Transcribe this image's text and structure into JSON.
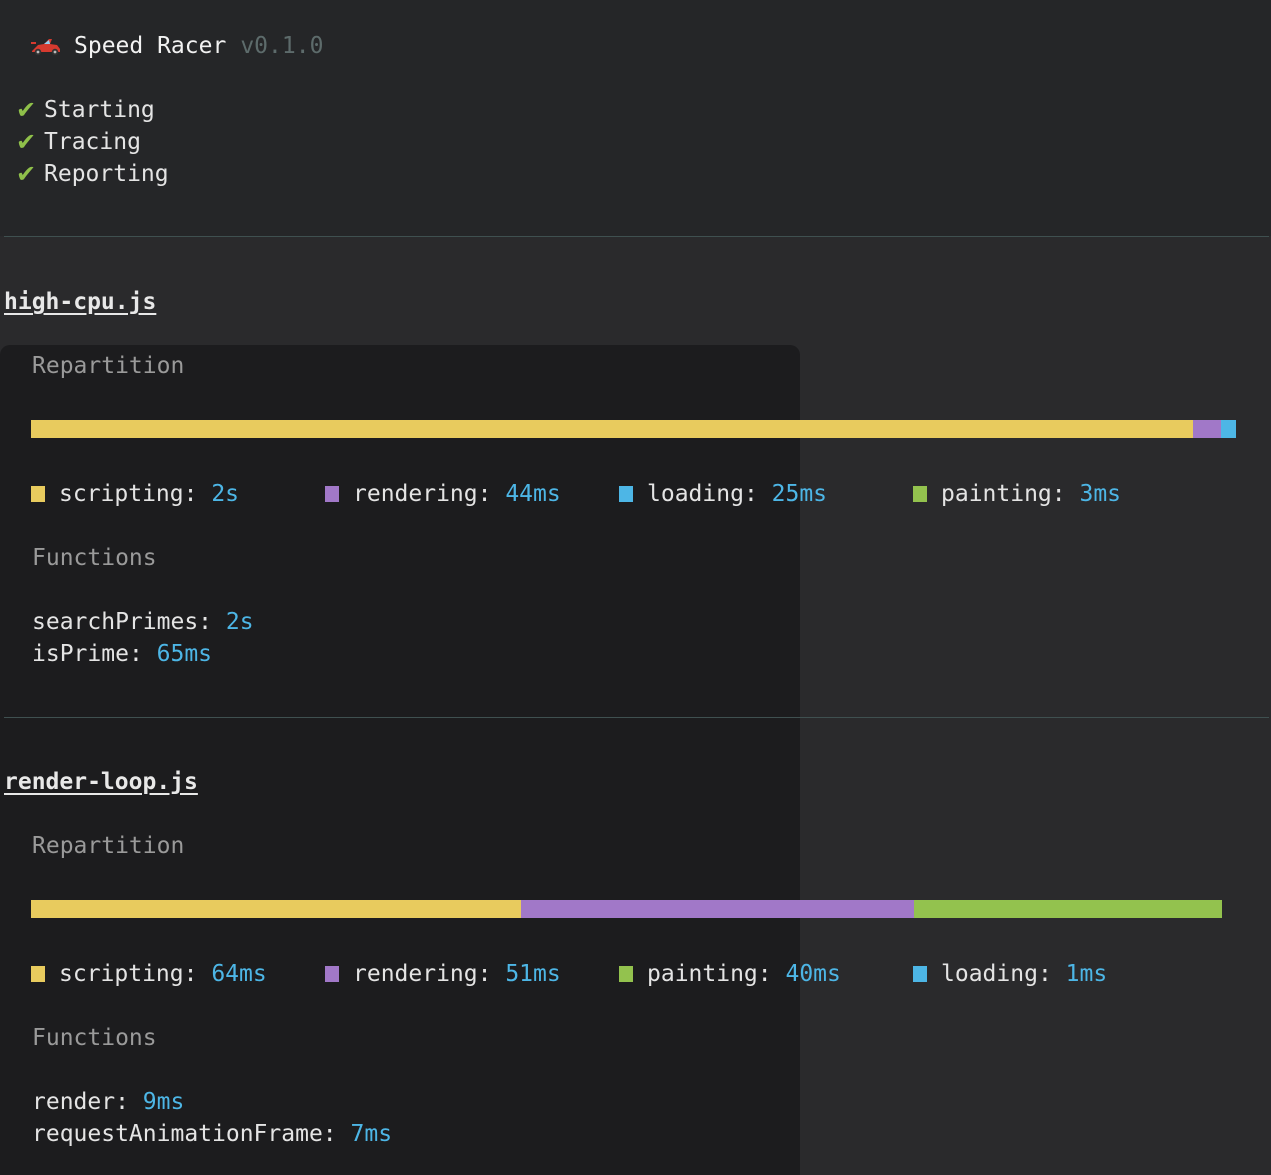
{
  "app": {
    "name": "Speed Racer",
    "version": "v0.1.0",
    "icon": "race-car-icon"
  },
  "steps": [
    {
      "label": "Starting",
      "icon": "check-icon"
    },
    {
      "label": "Tracing",
      "icon": "check-icon"
    },
    {
      "label": "Reporting",
      "icon": "check-icon"
    }
  ],
  "colors": {
    "scripting": "#e8cb5e",
    "rendering": "#a178c8",
    "loading": "#4db6e6",
    "painting": "#93c24e",
    "value": "#4db6e6",
    "check": "#8fc04a"
  },
  "reports": [
    {
      "file": "high-cpu.js",
      "repartition_label": "Repartition",
      "functions_label": "Functions",
      "bar": [
        {
          "category": "scripting",
          "fraction": 0.964
        },
        {
          "category": "rendering",
          "fraction": 0.0232
        },
        {
          "category": "loading",
          "fraction": 0.0124
        }
      ],
      "legend": [
        {
          "category": "scripting",
          "label": "scripting",
          "value": "2s"
        },
        {
          "category": "rendering",
          "label": "rendering",
          "value": "44ms"
        },
        {
          "category": "loading",
          "label": "loading",
          "value": "25ms"
        },
        {
          "category": "painting",
          "label": "painting",
          "value": "3ms"
        }
      ],
      "functions": [
        {
          "name": "searchPrimes",
          "value": "2s"
        },
        {
          "name": "isPrime",
          "value": "65ms"
        }
      ]
    },
    {
      "file": "render-loop.js",
      "repartition_label": "Repartition",
      "functions_label": "Functions",
      "bar": [
        {
          "category": "scripting",
          "fraction": 0.4118
        },
        {
          "category": "rendering",
          "fraction": 0.3294
        },
        {
          "category": "painting",
          "fraction": 0.2588
        }
      ],
      "legend": [
        {
          "category": "scripting",
          "label": "scripting",
          "value": "64ms"
        },
        {
          "category": "rendering",
          "label": "rendering",
          "value": "51ms"
        },
        {
          "category": "painting",
          "label": "painting",
          "value": "40ms"
        },
        {
          "category": "loading",
          "label": "loading",
          "value": "1ms"
        }
      ],
      "functions": [
        {
          "name": "render",
          "value": "9ms"
        },
        {
          "name": "requestAnimationFrame",
          "value": "7ms"
        }
      ]
    }
  ]
}
